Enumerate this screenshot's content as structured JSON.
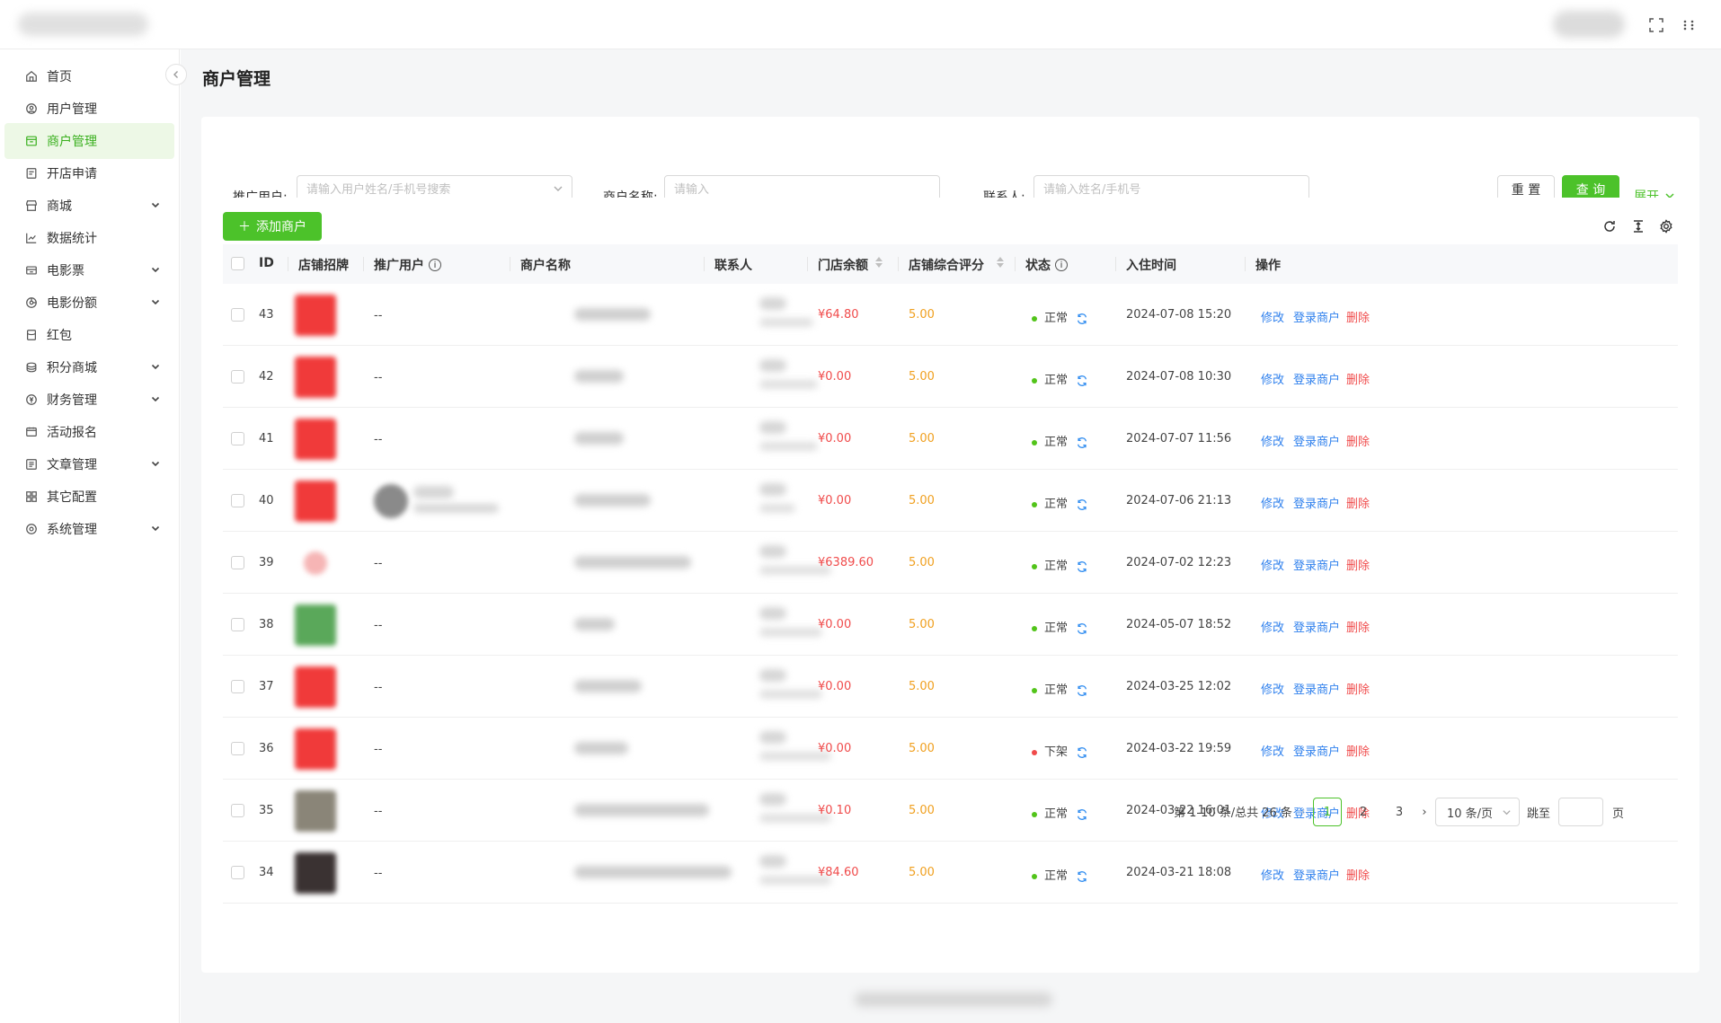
{
  "sidebar": {
    "items": [
      {
        "label": "首页",
        "icon": "home-icon",
        "expandable": false,
        "active": false
      },
      {
        "label": "用户管理",
        "icon": "user-icon",
        "expandable": false,
        "active": false
      },
      {
        "label": "商户管理",
        "icon": "store-icon",
        "expandable": false,
        "active": true
      },
      {
        "label": "开店申请",
        "icon": "apply-icon",
        "expandable": false,
        "active": false
      },
      {
        "label": "商城",
        "icon": "shop-icon",
        "expandable": true,
        "active": false
      },
      {
        "label": "数据统计",
        "icon": "chart-icon",
        "expandable": false,
        "active": false
      },
      {
        "label": "电影票",
        "icon": "ticket-icon",
        "expandable": true,
        "active": false
      },
      {
        "label": "电影份额",
        "icon": "share-icon",
        "expandable": true,
        "active": false
      },
      {
        "label": "红包",
        "icon": "redpacket-icon",
        "expandable": false,
        "active": false
      },
      {
        "label": "积分商城",
        "icon": "points-icon",
        "expandable": true,
        "active": false
      },
      {
        "label": "财务管理",
        "icon": "finance-icon",
        "expandable": true,
        "active": false
      },
      {
        "label": "活动报名",
        "icon": "activity-icon",
        "expandable": false,
        "active": false
      },
      {
        "label": "文章管理",
        "icon": "article-icon",
        "expandable": true,
        "active": false
      },
      {
        "label": "其它配置",
        "icon": "grid-icon",
        "expandable": false,
        "active": false
      },
      {
        "label": "系统管理",
        "icon": "settings-icon",
        "expandable": true,
        "active": false
      }
    ]
  },
  "page": {
    "title": "商户管理"
  },
  "filters": {
    "promoter_label": "推广用户:",
    "promoter_placeholder": "请输入用户姓名/手机号搜索",
    "merchant_label": "商户名称:",
    "merchant_placeholder": "请输入",
    "contact_label": "联系人:",
    "contact_placeholder": "请输入姓名/手机号",
    "reset_label": "重 置",
    "query_label": "查 询",
    "expand_label": "展开"
  },
  "toolbar": {
    "add_label": "添加商户"
  },
  "table": {
    "columns": [
      "ID",
      "店铺招牌",
      "推广用户",
      "商户名称",
      "联系人",
      "门店余额",
      "店铺综合评分",
      "状态",
      "入住时间",
      "操作"
    ],
    "rows": [
      {
        "id": "43",
        "promoter": "--",
        "balance": "¥64.80",
        "score": "5.00",
        "status": "正常",
        "status_color": "#52c41a",
        "time": "2024-07-08 15:20",
        "logo_color": "#f03a3a"
      },
      {
        "id": "42",
        "promoter": "--",
        "balance": "¥0.00",
        "score": "5.00",
        "status": "正常",
        "status_color": "#52c41a",
        "time": "2024-07-08 10:30",
        "logo_color": "#f03a3a"
      },
      {
        "id": "41",
        "promoter": "--",
        "balance": "¥0.00",
        "score": "5.00",
        "status": "正常",
        "status_color": "#52c41a",
        "time": "2024-07-07 11:56",
        "logo_color": "#f03a3a"
      },
      {
        "id": "40",
        "promoter": "",
        "balance": "¥0.00",
        "score": "5.00",
        "status": "正常",
        "status_color": "#52c41a",
        "time": "2024-07-06 21:13",
        "logo_color": "#f03a3a"
      },
      {
        "id": "39",
        "promoter": "--",
        "balance": "¥6389.60",
        "score": "5.00",
        "status": "正常",
        "status_color": "#52c41a",
        "time": "2024-07-02 12:23",
        "logo_color": "#f6b5b5"
      },
      {
        "id": "38",
        "promoter": "--",
        "balance": "¥0.00",
        "score": "5.00",
        "status": "正常",
        "status_color": "#52c41a",
        "time": "2024-05-07 18:52",
        "logo_color": "#5aa85a"
      },
      {
        "id": "37",
        "promoter": "--",
        "balance": "¥0.00",
        "score": "5.00",
        "status": "正常",
        "status_color": "#52c41a",
        "time": "2024-03-25 12:02",
        "logo_color": "#f03a3a"
      },
      {
        "id": "36",
        "promoter": "--",
        "balance": "¥0.00",
        "score": "5.00",
        "status": "下架",
        "status_color": "#f04b4b",
        "time": "2024-03-22 19:59",
        "logo_color": "#f03a3a"
      },
      {
        "id": "35",
        "promoter": "--",
        "balance": "¥0.10",
        "score": "5.00",
        "status": "正常",
        "status_color": "#52c41a",
        "time": "2024-03-22 16:01",
        "logo_color": "#8a8578"
      },
      {
        "id": "34",
        "promoter": "--",
        "balance": "¥84.60",
        "score": "5.00",
        "status": "正常",
        "status_color": "#52c41a",
        "time": "2024-03-21 18:08",
        "logo_color": "#3a3232"
      }
    ],
    "actions": {
      "edit": "修改",
      "login": "登录商户",
      "delete": "删除"
    }
  },
  "pagination": {
    "total_text": "第 1-10 条/总共 26 条",
    "pages": [
      "1",
      "2",
      "3"
    ],
    "current": "1",
    "page_size": "10 条/页",
    "jump_label": "跳至",
    "page_unit": "页"
  },
  "colors": {
    "accent": "#4cc22a",
    "link": "#2f80ed",
    "danger": "#f04b4b",
    "warning": "#f0a020"
  }
}
